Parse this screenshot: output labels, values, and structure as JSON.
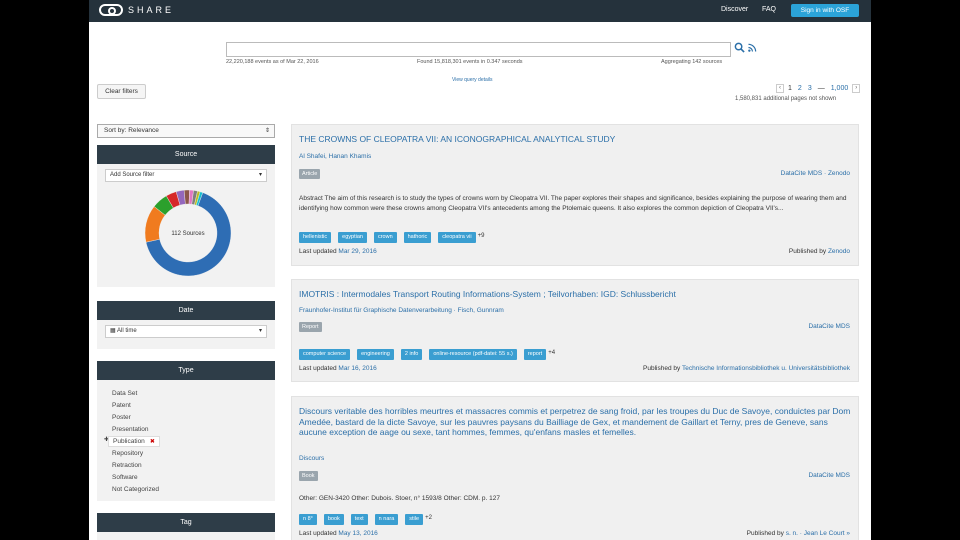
{
  "nav": {
    "logo_text": "SHARE",
    "discover": "Discover",
    "faq": "FAQ",
    "signin": "Sign in with OSF"
  },
  "search": {
    "value": "",
    "placeholder": "",
    "meta_left": "22,220,188 events as of Mar 22, 2016",
    "meta_center": "Found 15,818,301 events in 0.347 seconds",
    "meta_right": "Aggregating 142 sources",
    "query_link": "View query details"
  },
  "filters": {
    "clear_label": "Clear filters",
    "sort_label": "Sort by: Relevance"
  },
  "pagination": {
    "prev": "‹",
    "pages": [
      "1",
      "2",
      "3",
      "—",
      "1,000"
    ],
    "next": "›",
    "note": "1,580,831 additional pages not shown"
  },
  "source_panel": {
    "header": "Source",
    "select_label": "Add Source filter",
    "chart_label": "112 Sources"
  },
  "chart_data": {
    "type": "pie",
    "title": "",
    "center_label": "112 Sources",
    "values": [
      66,
      14,
      6,
      4,
      3,
      2,
      1.5,
      1.5,
      1,
      1
    ],
    "colors": [
      "#2e6db4",
      "#f07b1f",
      "#2ca02c",
      "#d62728",
      "#9467bd",
      "#8c564b",
      "#e377c2",
      "#7f7f7f",
      "#bcbd22",
      "#17becf"
    ]
  },
  "date_panel": {
    "header": "Date",
    "select_label": "All time"
  },
  "type_panel": {
    "header": "Type",
    "items": [
      "Data Set",
      "Patent",
      "Poster",
      "Presentation",
      "Publication",
      "Repository",
      "Retraction",
      "Software",
      "Not Categorized"
    ],
    "active_index": 4
  },
  "tag_panel": {
    "header": "Tag"
  },
  "results": [
    {
      "title": "THE CROWNS OF CLEOPATRA VII: AN ICONOGRAPHICAL ANALYTICAL STUDY",
      "authors": "Al Shafei, Hanan Khamis",
      "type": "Article",
      "source": "DataCite MDS · Zenodo",
      "abstract": "Abstract The aim of this research is to study the types of crowns worn by Cleopatra VII. The paper explores their shapes and significance, besides explaining the purpose of wearing them and identifying how common were these crowns among Cleopatra VII's antecedents among the Ptolemaic queens. It also explores the common depiction of Cleopatra VII's...",
      "tags": [
        "hellenistic",
        "egyptian",
        "crown",
        "hathoric",
        "cleopatra vii"
      ],
      "more": "+9",
      "updated_label": "Last updated",
      "updated": "Mar 29, 2016",
      "published_label": "Published by",
      "published": "Zenodo"
    },
    {
      "title": "IMOTRIS : Intermodales Transport Routing Informations-System ; Teilvorhaben: IGD: Schlussbericht",
      "authors": "Fraunhofer-Institut für Graphische Datenverarbeitung · Fisch, Gunnram",
      "type": "Report",
      "source": "DataCite MDS",
      "tags": [
        "computer science",
        "engineering",
        "2 info",
        "online-resource (pdf-datei: 55 s.)",
        "report"
      ],
      "more": "+4",
      "updated_label": "Last updated",
      "updated": "Mar 16, 2016",
      "published_label": "Published by",
      "published": "Technische Informationsbibliothek u. Universitätsbibliothek"
    },
    {
      "title": "Discours veritable des horribles meurtres et massacres commis et perpetrez de sang froid, par les troupes du Duc de Savoye, conduictes par Dom Amedée, bastard de la dicte Savoye, sur les pauvres paysans du Bailliage de Gex, et mandement de Gaillart et Terny, pres de Geneve, sans aucune exception de aage ou sexe, tant hommes, femmes, qu'enfans masles et femelles.",
      "authors": "Discours",
      "type": "Book",
      "source": "DataCite MDS",
      "other": "Other: GEN-3420 Other: Dubois. Stoer, n° 1593/8 Other: CDM. p. 127",
      "tags": [
        "n 8°",
        "book",
        "text",
        "n nara",
        "stile"
      ],
      "more": "+2",
      "updated_label": "Last updated",
      "updated": "May 13, 2016",
      "published_label": "Published by",
      "published": "s. n. · Jean Le Court »"
    }
  ]
}
